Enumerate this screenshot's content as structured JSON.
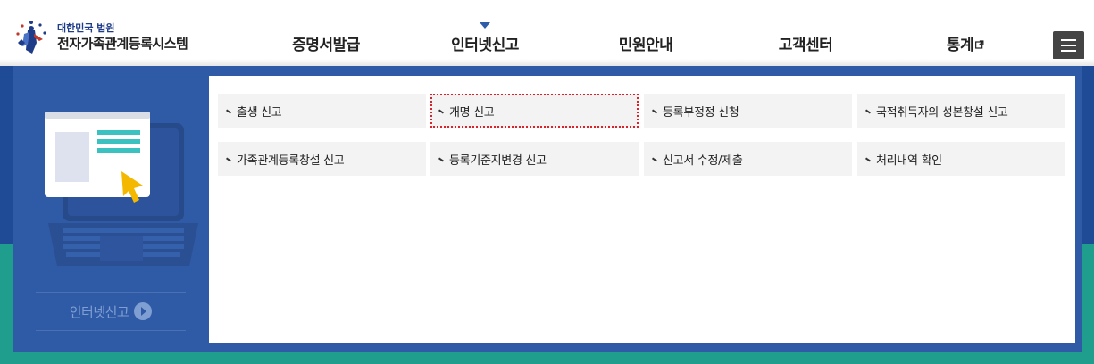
{
  "logo": {
    "org": "대한민국 법원",
    "system": "전자가족관계등록시스템"
  },
  "gnb": {
    "items": [
      {
        "label": "증명서발급"
      },
      {
        "label": "인터넷신고"
      },
      {
        "label": "민원안내"
      },
      {
        "label": "고객센터"
      },
      {
        "label": "통계"
      }
    ],
    "active_index": 1,
    "menu_icon": "hamburger-icon",
    "external_icon": "external-link-icon"
  },
  "panel": {
    "section_title": "인터넷신고",
    "items": [
      {
        "label": "출생 신고"
      },
      {
        "label": "개명 신고"
      },
      {
        "label": "등록부정정 신청"
      },
      {
        "label": "국적취득자의 성본창설 신고"
      },
      {
        "label": "가족관계등록창설 신고"
      },
      {
        "label": "등록기준지변경 신고"
      },
      {
        "label": "신고서 수정/제출"
      },
      {
        "label": "처리내역 확인"
      }
    ],
    "focused_index": 1
  },
  "colors": {
    "panel_blue": "#2f5aa5",
    "bg_blue": "#1e4a96",
    "bg_teal": "#1f9e8e",
    "focus_red": "#d9222a",
    "illustration_teal": "#3cc1c1",
    "cursor_yellow": "#f5b800"
  }
}
